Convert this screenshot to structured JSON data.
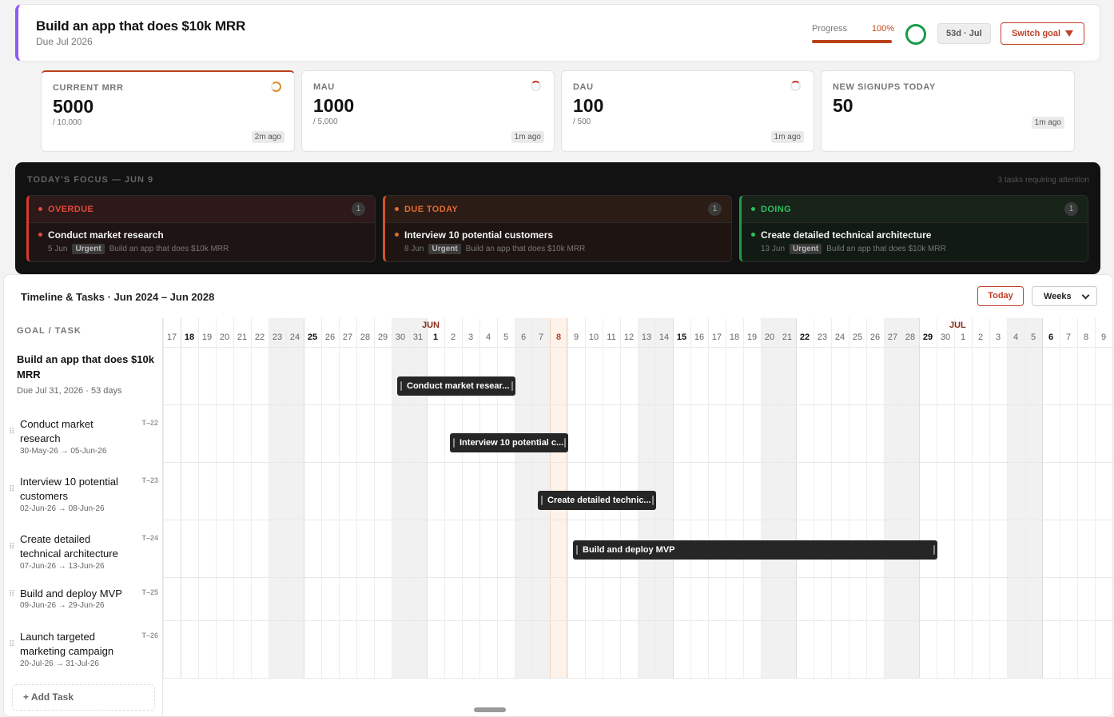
{
  "goal": {
    "title": "Build an app that does $10k MRR",
    "due": "Due Jul 2026",
    "progress_label": "Progress",
    "progress_value": "100%",
    "progress_fraction": 1.0,
    "days_chip": "53d · Jul",
    "switch_label": "Switch goal"
  },
  "metrics": [
    {
      "label": "CURRENT MRR",
      "value": "5000",
      "target": "/ 10,000",
      "ago": "2m ago"
    },
    {
      "label": "MAU",
      "value": "1000",
      "target": "/ 5,000",
      "ago": "1m ago"
    },
    {
      "label": "DAU",
      "value": "100",
      "target": "/ 500",
      "ago": "1m ago"
    },
    {
      "label": "NEW SIGNUPS TODAY",
      "value": "50",
      "target": "",
      "ago": "1m ago"
    }
  ],
  "focus": {
    "title": "TODAY'S FOCUS — JUN 9",
    "count": "3 tasks requiring attention",
    "columns": [
      {
        "label": "OVERDUE",
        "count": "1",
        "color": "#e24a3b",
        "task": "Conduct market research",
        "date": "5 Jun",
        "tag": "Urgent",
        "goal": "Build an app that does $10k MRR"
      },
      {
        "label": "DUE TODAY",
        "count": "1",
        "color": "#e26a32",
        "task": "Interview 10 potential customers",
        "date": "8 Jun",
        "tag": "Urgent",
        "goal": "Build an app that does $10k MRR"
      },
      {
        "label": "DOING",
        "count": "1",
        "color": "#2fbf5f",
        "task": "Create detailed technical architecture",
        "date": "13 Jun",
        "tag": "Urgent",
        "goal": "Build an app that does $10k MRR"
      }
    ]
  },
  "timeline": {
    "title": "Timeline & Tasks · Jun 2024 – Jun 2028",
    "today_label": "Today",
    "zoom_label": "Weeks",
    "column_header": "GOAL / TASK",
    "add_task": "+ Add Task",
    "months": [
      {
        "label": "JUN",
        "day_index": 15
      },
      {
        "label": "JUL",
        "day_index": 45
      }
    ],
    "days": [
      "17",
      "18",
      "19",
      "20",
      "21",
      "22",
      "23",
      "24",
      "25",
      "26",
      "27",
      "28",
      "29",
      "30",
      "31",
      "1",
      "2",
      "3",
      "4",
      "5",
      "6",
      "7",
      "8",
      "9",
      "10",
      "11",
      "12",
      "13",
      "14",
      "15",
      "16",
      "17",
      "18",
      "19",
      "20",
      "21",
      "22",
      "23",
      "24",
      "25",
      "26",
      "27",
      "28",
      "29",
      "30",
      "1",
      "2",
      "3",
      "4",
      "5",
      "6",
      "7",
      "8",
      "9"
    ],
    "weekend_days": [
      6,
      7,
      13,
      14,
      20,
      21,
      27,
      28,
      34,
      35,
      41,
      42,
      48,
      49
    ],
    "bold_days": [
      1,
      8,
      15,
      22,
      29,
      36,
      43,
      50
    ],
    "today_index": 22,
    "goal_row": {
      "title": "Build an app that does $10k MRR",
      "sub": "Due Jul 31, 2026 · 53 days"
    },
    "tasks": [
      {
        "name": "Conduct market research",
        "id": "T–22",
        "dates": "30-May-26 → 05-Jun-26",
        "bar_label": "Conduct market resear...",
        "start_index": 13,
        "end_index": 19
      },
      {
        "name": "Interview 10 potential customers",
        "id": "T–23",
        "dates": "02-Jun-26 → 08-Jun-26",
        "bar_label": "Interview 10 potential c...",
        "start_index": 16,
        "end_index": 22
      },
      {
        "name": "Create detailed technical architecture",
        "id": "T–24",
        "dates": "07-Jun-26 → 13-Jun-26",
        "bar_label": "Create detailed technic...",
        "start_index": 21,
        "end_index": 27
      },
      {
        "name": "Build and deploy MVP",
        "id": "T–25",
        "dates": "09-Jun-26 → 29-Jun-26",
        "bar_label": "Build and deploy MVP",
        "start_index": 23,
        "end_index": 43
      },
      {
        "name": "Launch targeted marketing campaign",
        "id": "T–26",
        "dates": "20-Jul-26 → 31-Jul-26",
        "bar_label": "",
        "start_index": -1,
        "end_index": -1
      }
    ]
  }
}
